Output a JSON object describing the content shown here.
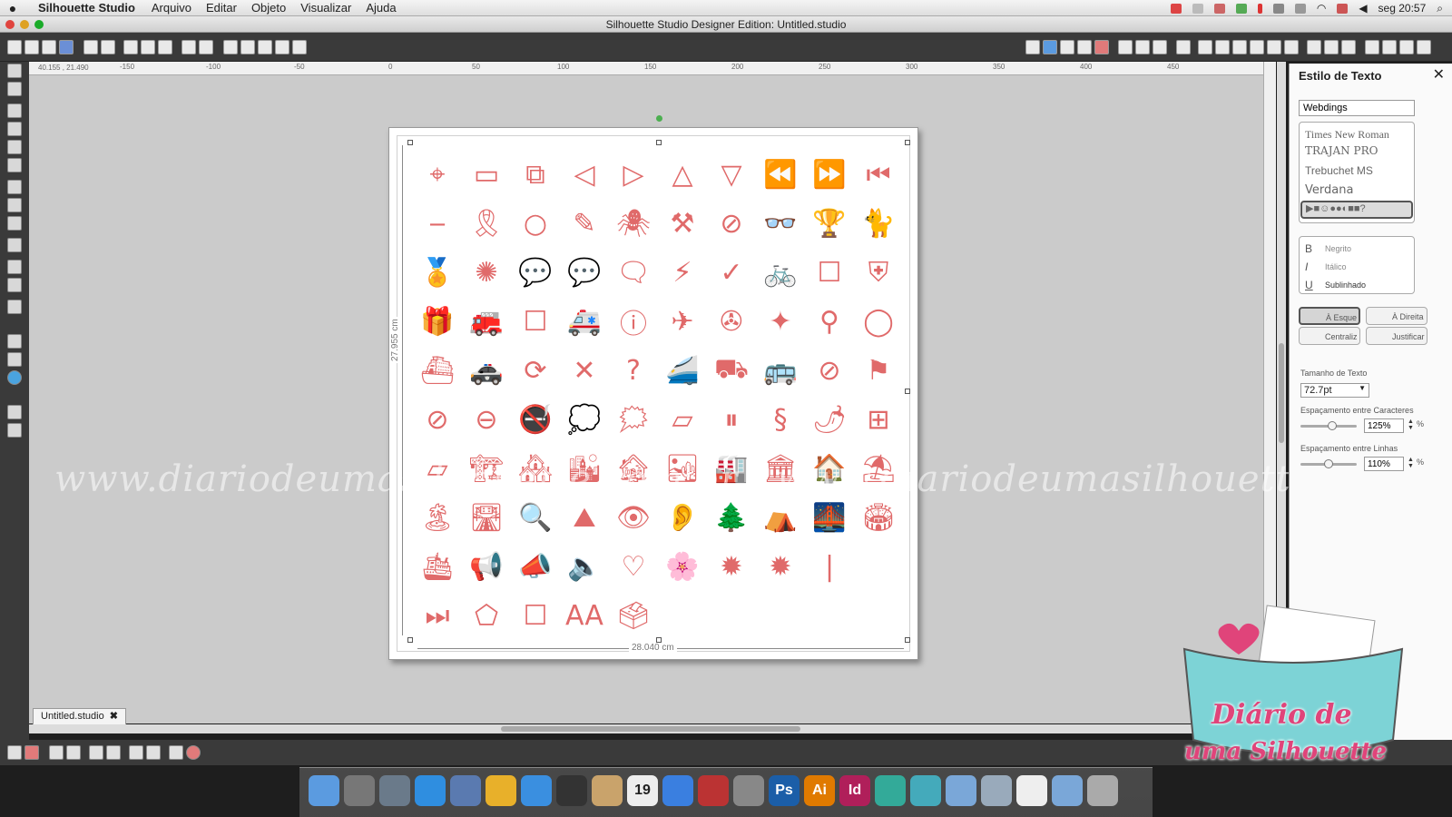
{
  "menubar": {
    "app_name": "Silhouette Studio",
    "menus": [
      "Arquivo",
      "Editar",
      "Objeto",
      "Visualizar",
      "Ajuda"
    ],
    "clock": "seg 20:57"
  },
  "window": {
    "title": "Silhouette Studio Designer Edition: Untitled.studio"
  },
  "ruler": {
    "coords": "40.155 , 21.490",
    "ticks": [
      "-150",
      "-100",
      "-50",
      "0",
      "50",
      "100",
      "150",
      "200",
      "250",
      "300",
      "350",
      "400",
      "450"
    ]
  },
  "canvas": {
    "width_label": "28.040 cm",
    "height_label": "27.955 cm",
    "glyph_color": "#e06a6a",
    "glyphs": [
      "⌖",
      "▭",
      "⧉",
      "◁",
      "▷",
      "△",
      "▽",
      "⏪",
      "⏩",
      "⏮",
      "‒",
      "🎗",
      "○",
      "✎",
      "🕷",
      "⚒",
      "⊘",
      "👓",
      "🏆",
      "🐈",
      "🏅",
      "✺",
      "💬",
      "💬",
      "🗨",
      "⚡",
      "✓",
      "🚲",
      "☐",
      "⛨",
      "🎁",
      "🚒",
      "☐",
      "🚑",
      "ⓘ",
      "✈",
      "✇",
      "✦",
      "⚲",
      "◯",
      "⛴",
      "🚓",
      "⟳",
      "✕",
      "?",
      "🚄",
      "⛟",
      "🚌",
      "⊘",
      "⚑",
      "⊘",
      "⊖",
      "🚭",
      "💭",
      "🗯",
      "▱",
      "⏸",
      "§",
      "🌶",
      "⊞",
      "▱",
      "🏗",
      "🏘",
      "🏙",
      "🏚",
      "🏜",
      "🏭",
      "🏛",
      "🏠",
      "⛱",
      "🏝",
      "🛣",
      "🔍",
      "⛰",
      "👁",
      "👂",
      "🌲",
      "⛺",
      "🌉",
      "🏟",
      "🛳",
      "📢",
      "📣",
      "🔈",
      "♡",
      "🌸",
      "✹",
      "✹",
      "|",
      "",
      "⏭",
      "⬠",
      "☐",
      "AA",
      "🗳",
      "",
      "",
      "",
      "",
      ""
    ]
  },
  "watermark": "www.diariodeumasilhouette.com.br | www.diariodeumasilhouette.com.br",
  "doc_tab": {
    "label": "Untitled.studio",
    "close": "✖"
  },
  "panel": {
    "title": "Estilo de Texto",
    "close": "✕",
    "font_value": "Webdings",
    "fonts": [
      "Times New Roman",
      "TRAJAN PRO",
      "Trebuchet MS",
      "Verdana"
    ],
    "selected_font_preview": "▶■☺●●◐■■?",
    "styles": [
      {
        "glyph": "B",
        "label": "Negrito"
      },
      {
        "glyph": "I",
        "label": "Itálico"
      },
      {
        "glyph": "U",
        "label": "Sublinhado"
      }
    ],
    "align": [
      "À Esque",
      "À Direita",
      "Centraliz",
      "Justificar"
    ],
    "size_label": "Tamanho de Texto",
    "size_value": "72.7pt",
    "char_spacing_label": "Espaçamento entre Caracteres",
    "char_spacing_value": "125%",
    "line_spacing_label": "Espaçamento entre Linhas",
    "line_spacing_value": "110%",
    "percent": "%"
  },
  "logo": {
    "line1": "Diário de",
    "line2": "uma Silhouette"
  },
  "dock": {
    "apps": [
      "Finder",
      "Launchpad",
      "Preview",
      "App Store",
      "Preview",
      "Chrome",
      "Safari",
      "FaceTime",
      "Contacts",
      "Calendar",
      "iTunes",
      "Photo",
      "System Preferences",
      "Ps",
      "Ai",
      "Id",
      "Palette",
      "Silhouette",
      "Folder",
      "Documents",
      "Text",
      "Downloads",
      "Trash"
    ],
    "calendar_day": "19",
    "ps": "Ps",
    "ai": "Ai",
    "id": "Id"
  }
}
